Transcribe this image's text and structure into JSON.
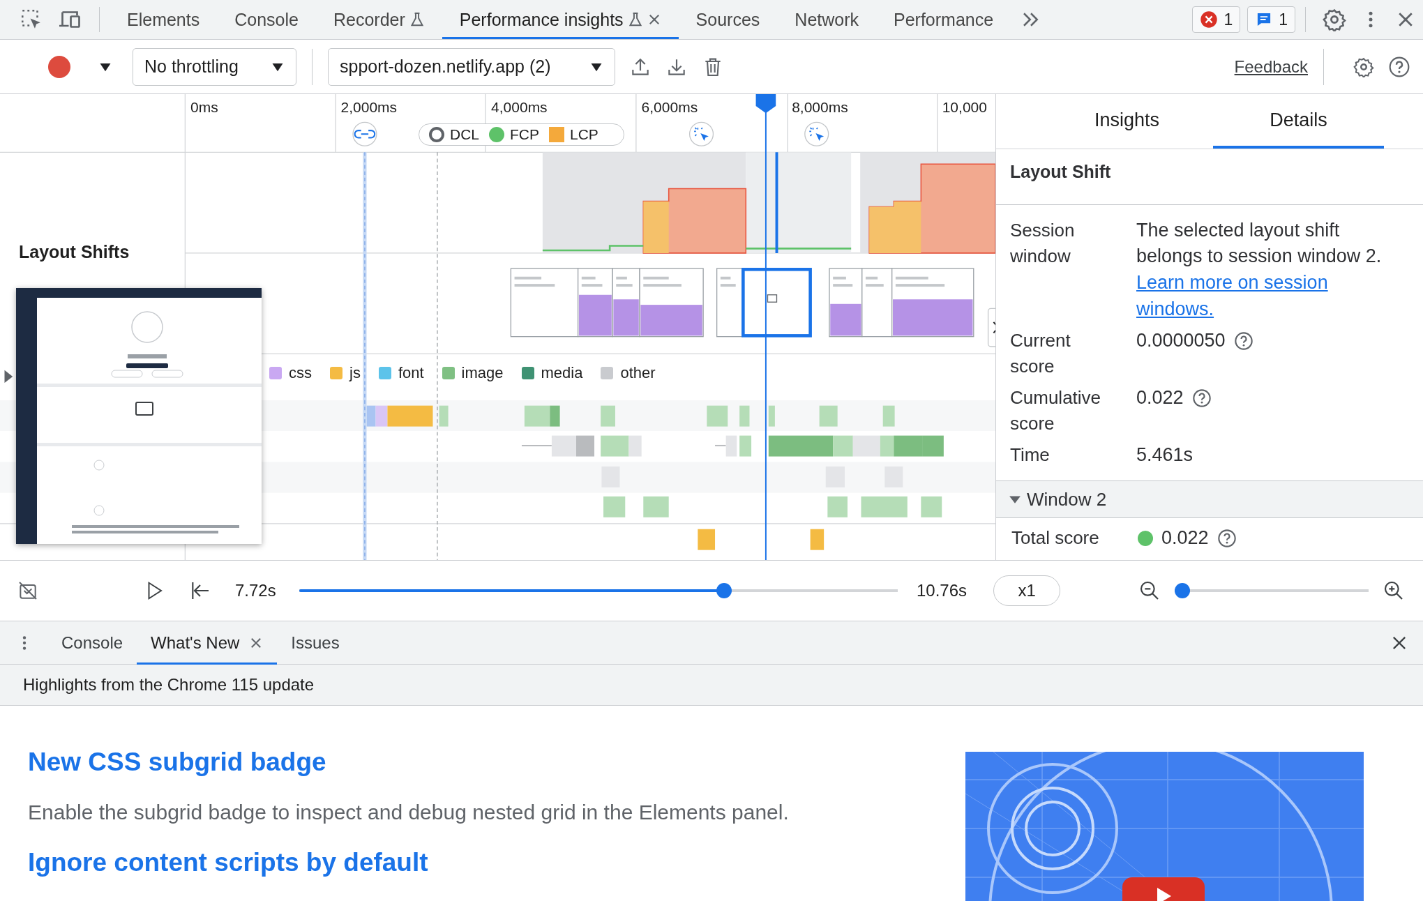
{
  "tabs": [
    {
      "label": "Elements",
      "selected": false,
      "experimental": false,
      "closable": false
    },
    {
      "label": "Console",
      "selected": false,
      "experimental": false,
      "closable": false
    },
    {
      "label": "Recorder",
      "selected": false,
      "experimental": true,
      "closable": false
    },
    {
      "label": "Performance insights",
      "selected": true,
      "experimental": true,
      "closable": true
    },
    {
      "label": "Sources",
      "selected": false,
      "experimental": false,
      "closable": false
    },
    {
      "label": "Network",
      "selected": false,
      "experimental": false,
      "closable": false
    },
    {
      "label": "Performance",
      "selected": false,
      "experimental": false,
      "closable": false
    }
  ],
  "issue_badges": [
    {
      "kind": "error",
      "count": "1"
    },
    {
      "kind": "message",
      "count": "1"
    }
  ],
  "toolbar": {
    "throttling": "No throttling",
    "recording": "spport-dozen.netlify.app (2)",
    "feedback": "Feedback"
  },
  "timeline": {
    "ticks": [
      "0ms",
      "2,000ms",
      "4,000ms",
      "6,000ms",
      "8,000ms",
      "10,000"
    ],
    "markers": [
      {
        "label": "DCL",
        "kind": "hollow",
        "color": "#5f6368"
      },
      {
        "label": "FCP",
        "kind": "dot",
        "color": "#5ec269"
      },
      {
        "label": "LCP",
        "kind": "square",
        "color": "#f4a93b"
      }
    ],
    "track_label": "Layout Shifts",
    "legend": [
      {
        "label": "css",
        "color": "#c9a8f2"
      },
      {
        "label": "js",
        "color": "#f4bb43"
      },
      {
        "label": "font",
        "color": "#5cc3ea"
      },
      {
        "label": "image",
        "color": "#7fc083"
      },
      {
        "label": "media",
        "color": "#3f9273"
      },
      {
        "label": "other",
        "color": "#c9cbcf"
      }
    ]
  },
  "details_panel": {
    "tabs": [
      {
        "label": "Insights",
        "selected": false
      },
      {
        "label": "Details",
        "selected": true
      }
    ],
    "title": "Layout Shift",
    "rows": [
      {
        "label": "Session window",
        "value": "The selected layout shift belongs to session window 2.",
        "link": "Learn more on session windows.",
        "help": false
      },
      {
        "label": "Current score",
        "value": "0.0000050",
        "help": true
      },
      {
        "label": "Cumulative score",
        "value": "0.022",
        "help": true
      },
      {
        "label": "Time",
        "value": "5.461s",
        "help": false
      }
    ],
    "window": {
      "label": "Window 2",
      "expanded": true,
      "rows": [
        {
          "label": "Total score",
          "value": "0.022",
          "color": "#5ec269",
          "help": true
        }
      ]
    }
  },
  "playback": {
    "current": "7.72s",
    "end": "10.76s",
    "speed": "x1"
  },
  "scrubber": {
    "level": 0.71
  },
  "zoom": {
    "level": 0.04
  },
  "drawer": {
    "tabs": [
      {
        "label": "Console",
        "selected": false,
        "closable": false
      },
      {
        "label": "What's New",
        "selected": true,
        "closable": true
      },
      {
        "label": "Issues",
        "selected": false,
        "closable": false
      }
    ],
    "banner": "Highlights from the Chrome 115 update",
    "articles": [
      {
        "title": "New CSS subgrid badge",
        "text": "Enable the subgrid badge to inspect and debug nested grid in the Elements panel."
      },
      {
        "title": "Ignore content scripts by default"
      }
    ]
  }
}
